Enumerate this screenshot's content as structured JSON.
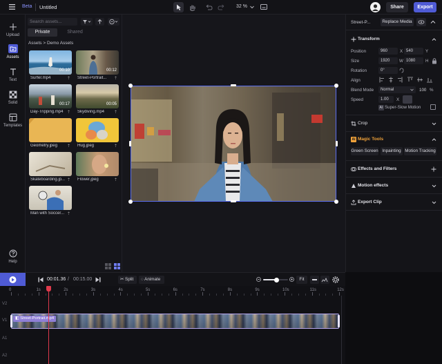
{
  "topbar": {
    "beta_badge": "Beta",
    "project_title": "Untitled",
    "zoom": "32 %",
    "share_label": "Share",
    "export_label": "Export"
  },
  "rail": {
    "items": [
      {
        "label": "Upload",
        "icon": "plus-icon"
      },
      {
        "label": "Assets",
        "icon": "folder-icon"
      },
      {
        "label": "Text",
        "icon": "text-icon"
      },
      {
        "label": "Solid",
        "icon": "checker-icon"
      },
      {
        "label": "Templates",
        "icon": "template-icon"
      }
    ],
    "help_label": "Help"
  },
  "assets": {
    "search_placeholder": "Search assets...",
    "tab_private": "Private",
    "tab_shared": "Shared",
    "breadcrumb_root": "Assets",
    "breadcrumb_sep": ">",
    "breadcrumb_current": "Demo Assets",
    "items": [
      {
        "name": "Surfer.mp4",
        "duration": "00:10"
      },
      {
        "name": "Street-Portrait...",
        "duration": "00:12"
      },
      {
        "name": "Day-Tripping.mp4",
        "duration": "00:17"
      },
      {
        "name": "Skydiving.mp4",
        "duration": "00:05"
      },
      {
        "name": "Geometry.jpeg",
        "duration": ""
      },
      {
        "name": "Hug.jpeg",
        "duration": ""
      },
      {
        "name": "Skateboarding.jp...",
        "duration": ""
      },
      {
        "name": "Flower.jpeg",
        "duration": ""
      },
      {
        "name": "Man with Soccer...",
        "duration": ""
      }
    ]
  },
  "props": {
    "clip_name": "Street-P...",
    "replace_media": "Replace Media",
    "transform": "Transform",
    "position_label": "Position",
    "pos_x": "960",
    "pos_x_axis": "X",
    "pos_y": "540",
    "pos_y_axis": "Y",
    "size_label": "Size",
    "size_w": "1920",
    "size_w_axis": "W",
    "size_h": "1080",
    "size_h_axis": "H",
    "rotation_label": "Rotation",
    "rotation": "0°",
    "align_label": "Align",
    "blend_label": "Blend Mode",
    "blend_value": "Normal",
    "opacity": "100",
    "opacity_unit": "%",
    "speed_label": "Speed",
    "speed_value": "1.00",
    "speed_x": "X",
    "ai_badge": "AI",
    "slow_motion_label": "Super-Slow Motion",
    "crop": "Crop",
    "magic_tools": "Magic Tools",
    "green_screen": "Green Screen",
    "inpainting": "Inpainting",
    "motion_tracking": "Motion Tracking",
    "effects_filters": "Effects and Filters",
    "motion_effects": "Motion effects",
    "export_clip": "Export Clip"
  },
  "timeline": {
    "current_time": "00:01.36",
    "time_sep": "/",
    "total_time": "00:15.00",
    "split_label": "Split",
    "animate_label": "Animate",
    "fit_label": "Fit",
    "zoom_level": 0.55,
    "ticks": [
      "0",
      "1s",
      "2s",
      "3s",
      "4s",
      "5s",
      "6s",
      "7s",
      "8s",
      "9s",
      "10s",
      "11s",
      "12s"
    ],
    "tracks": [
      "V2",
      "V1",
      "A1",
      "A2"
    ],
    "clip_name": "Street-Portrait.mp4",
    "playhead_seconds": 1.36
  },
  "colors": {
    "accent": "#4f5bd5",
    "playhead": "#e03a4c",
    "selection": "#5a6ef0",
    "clip": "#8f7fd6",
    "magic": "#f0a23a"
  }
}
